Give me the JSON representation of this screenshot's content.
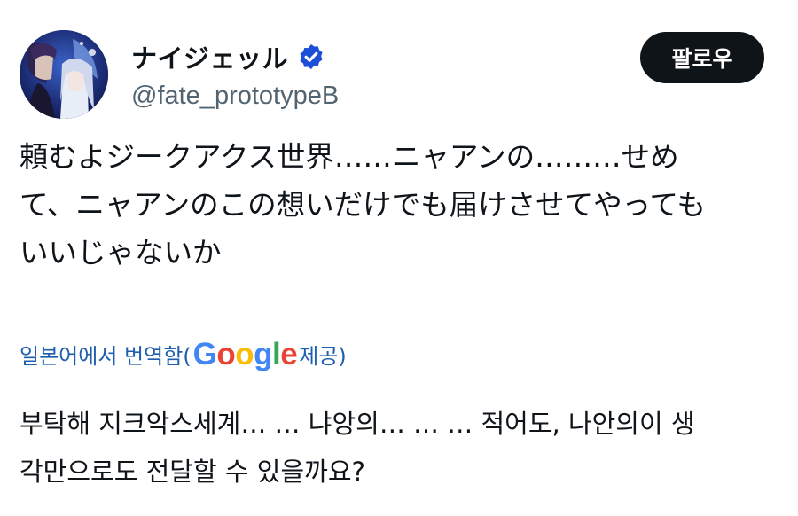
{
  "author": {
    "display_name": "ナイジェッル",
    "handle": "@fate_prototypeB",
    "verified": true,
    "avatar_icon": "profile-avatar"
  },
  "follow_button": {
    "label": "팔로우"
  },
  "tweet": {
    "text_lines": [
      "頼むよジークアクス世界……ニャアンの………せめ",
      "て、ニャアンのこの想いだけでも届けさせてやっても",
      "いいじゃないか"
    ]
  },
  "translation": {
    "prefix": "일본어에서 번역함(",
    "provider_letters": [
      "G",
      "o",
      "o",
      "g",
      "l",
      "e"
    ],
    "provider_colors": [
      "#4285F4",
      "#EA4335",
      "#FBBC05",
      "#4285F4",
      "#34A853",
      "#EA4335"
    ],
    "suffix": " 제공)",
    "text_lines": [
      "부탁해 지크악스세계… … 냐앙의… … … 적어도, 나안의이 생",
      "각만으로도 전달할 수 있을까요?"
    ]
  },
  "colors": {
    "text": "#0f1419",
    "secondary": "#536471",
    "link": "#1d5fae",
    "verified_badge": "#1d4ed8",
    "button_bg": "#0f1419"
  }
}
